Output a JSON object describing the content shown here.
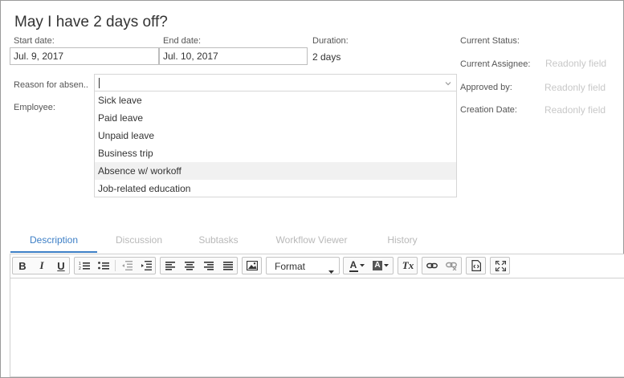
{
  "title": "May I have 2 days off?",
  "form": {
    "start_date": {
      "label": "Start date:",
      "value": "Jul. 9, 2017"
    },
    "end_date": {
      "label": "End date:",
      "value": "Jul. 10, 2017"
    },
    "duration": {
      "label": "Duration:",
      "value": "2 days"
    },
    "reason": {
      "label": "Reason for absen..",
      "value": ""
    },
    "employee": {
      "label": "Employee:"
    }
  },
  "side_info": {
    "current_status": {
      "label": "Current Status:",
      "value": ""
    },
    "current_assignee": {
      "label": "Current Assignee:",
      "value": "Readonly field"
    },
    "approved_by": {
      "label": "Approved by:",
      "value": "Readonly field"
    },
    "creation_date": {
      "label": "Creation Date:",
      "value": "Readonly field"
    }
  },
  "dropdown": {
    "options": [
      "Sick leave",
      "Paid leave",
      "Unpaid leave",
      "Business trip",
      "Absence w/ workoff",
      "Job-related education"
    ],
    "highlighted_index": 4
  },
  "tabs": [
    {
      "label": "Description",
      "active": true
    },
    {
      "label": "Discussion",
      "active": false
    },
    {
      "label": "Subtasks",
      "active": false
    },
    {
      "label": "Workflow Viewer",
      "active": false
    },
    {
      "label": "History",
      "active": false
    }
  ],
  "toolbar": {
    "bold": "B",
    "italic": "I",
    "underline": "U",
    "format_label": "Format",
    "text_color": "A",
    "bg_color": "A",
    "remove_format": "Tx",
    "icons": [
      "bold-icon",
      "italic-icon",
      "underline-icon",
      "numbered-list-icon",
      "bulleted-list-icon",
      "outdent-icon",
      "indent-icon",
      "align-left-icon",
      "align-center-icon",
      "align-right-icon",
      "justify-icon",
      "image-icon",
      "chevron-down-icon",
      "text-color-icon",
      "background-color-icon",
      "remove-format-icon",
      "link-icon",
      "unlink-icon",
      "source-icon",
      "maximize-icon"
    ]
  },
  "colors": {
    "accent": "#3d7fc6",
    "readonly": "#c8c8c8",
    "highlight": "#f1f1f1"
  }
}
